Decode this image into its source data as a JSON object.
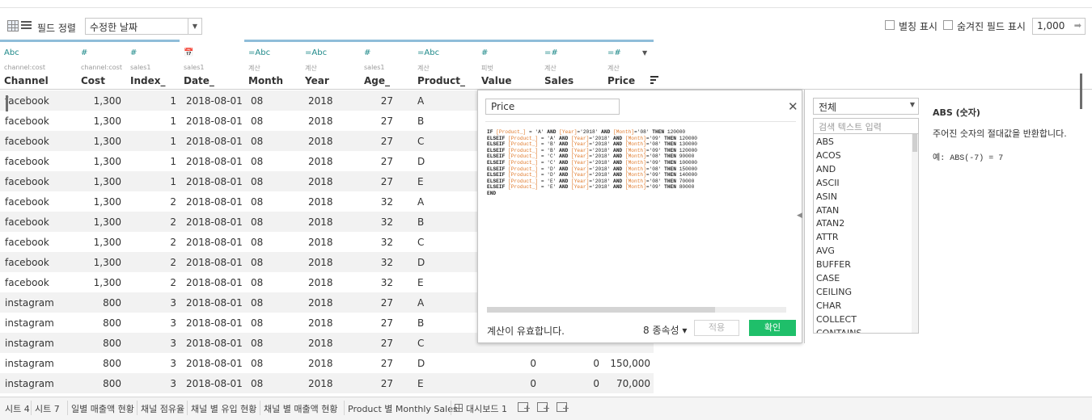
{
  "toolbar": {
    "sort_label": "필드 정렬",
    "sort_value": "수정한 날짜",
    "alias_label": "별칭 표시",
    "hidden_label": "숨겨진 필드 표시",
    "rows_value": "1,000"
  },
  "columns": [
    {
      "type": "Abc",
      "source": "channel:cost",
      "name": "Channel"
    },
    {
      "type": "#",
      "source": "channel:cost",
      "name": "Cost"
    },
    {
      "type": "#",
      "source": "sales1",
      "name": "Index_"
    },
    {
      "type": "📅",
      "source": "sales1",
      "name": "Date_"
    },
    {
      "type": "=Abc",
      "source": "계산",
      "name": "Month"
    },
    {
      "type": "=Abc",
      "source": "계산",
      "name": "Year"
    },
    {
      "type": "#",
      "source": "sales1",
      "name": "Age_"
    },
    {
      "type": "=Abc",
      "source": "계산",
      "name": "Product_"
    },
    {
      "type": "#",
      "source": "피벗",
      "name": "Value"
    },
    {
      "type": "=#",
      "source": "계산",
      "name": "Sales"
    },
    {
      "type": "=#",
      "source": "계산",
      "name": "Price"
    }
  ],
  "rows": [
    {
      "channel": "facebook",
      "cost": "1,300",
      "index": "1",
      "date": "2018-08-01",
      "month": "08",
      "year": "2018",
      "age": "27",
      "product": "A"
    },
    {
      "channel": "facebook",
      "cost": "1,300",
      "index": "1",
      "date": "2018-08-01",
      "month": "08",
      "year": "2018",
      "age": "27",
      "product": "B"
    },
    {
      "channel": "facebook",
      "cost": "1,300",
      "index": "1",
      "date": "2018-08-01",
      "month": "08",
      "year": "2018",
      "age": "27",
      "product": "C"
    },
    {
      "channel": "facebook",
      "cost": "1,300",
      "index": "1",
      "date": "2018-08-01",
      "month": "08",
      "year": "2018",
      "age": "27",
      "product": "D"
    },
    {
      "channel": "facebook",
      "cost": "1,300",
      "index": "1",
      "date": "2018-08-01",
      "month": "08",
      "year": "2018",
      "age": "27",
      "product": "E"
    },
    {
      "channel": "facebook",
      "cost": "1,300",
      "index": "2",
      "date": "2018-08-01",
      "month": "08",
      "year": "2018",
      "age": "32",
      "product": "A"
    },
    {
      "channel": "facebook",
      "cost": "1,300",
      "index": "2",
      "date": "2018-08-01",
      "month": "08",
      "year": "2018",
      "age": "32",
      "product": "B"
    },
    {
      "channel": "facebook",
      "cost": "1,300",
      "index": "2",
      "date": "2018-08-01",
      "month": "08",
      "year": "2018",
      "age": "32",
      "product": "C"
    },
    {
      "channel": "facebook",
      "cost": "1,300",
      "index": "2",
      "date": "2018-08-01",
      "month": "08",
      "year": "2018",
      "age": "32",
      "product": "D"
    },
    {
      "channel": "facebook",
      "cost": "1,300",
      "index": "2",
      "date": "2018-08-01",
      "month": "08",
      "year": "2018",
      "age": "32",
      "product": "E"
    },
    {
      "channel": "instagram",
      "cost": "800",
      "index": "3",
      "date": "2018-08-01",
      "month": "08",
      "year": "2018",
      "age": "27",
      "product": "A"
    },
    {
      "channel": "instagram",
      "cost": "800",
      "index": "3",
      "date": "2018-08-01",
      "month": "08",
      "year": "2018",
      "age": "27",
      "product": "B"
    },
    {
      "channel": "instagram",
      "cost": "800",
      "index": "3",
      "date": "2018-08-01",
      "month": "08",
      "year": "2018",
      "age": "27",
      "product": "C"
    },
    {
      "channel": "instagram",
      "cost": "800",
      "index": "3",
      "date": "2018-08-01",
      "month": "08",
      "year": "2018",
      "age": "27",
      "product": "D",
      "value": "0",
      "sales": "0",
      "price": "150,000"
    },
    {
      "channel": "instagram",
      "cost": "800",
      "index": "3",
      "date": "2018-08-01",
      "month": "08",
      "year": "2018",
      "age": "27",
      "product": "E",
      "value": "0",
      "sales": "0",
      "price": "70,000"
    }
  ],
  "calc": {
    "name": "Price",
    "code": [
      [
        [
          "kw",
          "IF "
        ],
        [
          "fld",
          "[Product_]"
        ],
        [
          "t",
          " = 'A' "
        ],
        [
          "kw",
          "AND "
        ],
        [
          "fld",
          "[Year]"
        ],
        [
          "t",
          "='2018' "
        ],
        [
          "kw",
          "AND "
        ],
        [
          "fld",
          "[Month]"
        ],
        [
          "t",
          "='08' "
        ],
        [
          "kw",
          "THEN "
        ],
        [
          "t",
          "120000"
        ]
      ],
      [
        [
          "kw",
          "ELSEIF "
        ],
        [
          "fld",
          "[Product_]"
        ],
        [
          "t",
          " = 'A' "
        ],
        [
          "kw",
          "AND "
        ],
        [
          "fld",
          "[Year]"
        ],
        [
          "t",
          "='2018' "
        ],
        [
          "kw",
          "AND "
        ],
        [
          "fld",
          "[Month]"
        ],
        [
          "t",
          "='09' "
        ],
        [
          "kw",
          "THEN "
        ],
        [
          "t",
          "120000"
        ]
      ],
      [
        [
          "kw",
          "ELSEIF "
        ],
        [
          "fld",
          "[Product_]"
        ],
        [
          "t",
          " = 'B' "
        ],
        [
          "kw",
          "AND "
        ],
        [
          "fld",
          "[Year]"
        ],
        [
          "t",
          "='2018' "
        ],
        [
          "kw",
          "AND "
        ],
        [
          "fld",
          "[Month]"
        ],
        [
          "t",
          "='08' "
        ],
        [
          "kw",
          "THEN "
        ],
        [
          "t",
          "130000"
        ]
      ],
      [
        [
          "kw",
          "ELSEIF "
        ],
        [
          "fld",
          "[Product_]"
        ],
        [
          "t",
          " = 'B' "
        ],
        [
          "kw",
          "AND "
        ],
        [
          "fld",
          "[Year]"
        ],
        [
          "t",
          "='2018' "
        ],
        [
          "kw",
          "AND "
        ],
        [
          "fld",
          "[Month]"
        ],
        [
          "t",
          "='09' "
        ],
        [
          "kw",
          "THEN "
        ],
        [
          "t",
          "120000"
        ]
      ],
      [
        [
          "kw",
          "ELSEIF "
        ],
        [
          "fld",
          "[Product_]"
        ],
        [
          "t",
          " = 'C' "
        ],
        [
          "kw",
          "AND "
        ],
        [
          "fld",
          "[Year]"
        ],
        [
          "t",
          "='2018' "
        ],
        [
          "kw",
          "AND "
        ],
        [
          "fld",
          "[Month]"
        ],
        [
          "t",
          "='08' "
        ],
        [
          "kw",
          "THEN "
        ],
        [
          "t",
          "90000"
        ]
      ],
      [
        [
          "kw",
          "ELSEIF "
        ],
        [
          "fld",
          "[Product_]"
        ],
        [
          "t",
          " = 'C' "
        ],
        [
          "kw",
          "AND "
        ],
        [
          "fld",
          "[Year]"
        ],
        [
          "t",
          "='2018' "
        ],
        [
          "kw",
          "AND "
        ],
        [
          "fld",
          "[Month]"
        ],
        [
          "t",
          "='09' "
        ],
        [
          "kw",
          "THEN "
        ],
        [
          "t",
          "100000"
        ]
      ],
      [
        [
          "kw",
          "ELSEIF "
        ],
        [
          "fld",
          "[Product_]"
        ],
        [
          "t",
          " = 'D' "
        ],
        [
          "kw",
          "AND "
        ],
        [
          "fld",
          "[Year]"
        ],
        [
          "t",
          "='2018' "
        ],
        [
          "kw",
          "AND "
        ],
        [
          "fld",
          "[Month]"
        ],
        [
          "t",
          "='08' "
        ],
        [
          "kw",
          "THEN "
        ],
        [
          "t",
          "150000"
        ]
      ],
      [
        [
          "kw",
          "ELSEIF "
        ],
        [
          "fld",
          "[Product_]"
        ],
        [
          "t",
          " = 'D' "
        ],
        [
          "kw",
          "AND "
        ],
        [
          "fld",
          "[Year]"
        ],
        [
          "t",
          "='2018' "
        ],
        [
          "kw",
          "AND "
        ],
        [
          "fld",
          "[Month]"
        ],
        [
          "t",
          "='09' "
        ],
        [
          "kw",
          "THEN "
        ],
        [
          "t",
          "140000"
        ]
      ],
      [
        [
          "kw",
          "ELSEIF "
        ],
        [
          "fld",
          "[Product_]"
        ],
        [
          "t",
          " = 'E' "
        ],
        [
          "kw",
          "AND "
        ],
        [
          "fld",
          "[Year]"
        ],
        [
          "t",
          "='2018' "
        ],
        [
          "kw",
          "AND "
        ],
        [
          "fld",
          "[Month]"
        ],
        [
          "t",
          "='08' "
        ],
        [
          "kw",
          "THEN "
        ],
        [
          "t",
          "70000"
        ]
      ],
      [
        [
          "kw",
          "ELSEIF "
        ],
        [
          "fld",
          "[Product_]"
        ],
        [
          "t",
          " = 'E' "
        ],
        [
          "kw",
          "AND "
        ],
        [
          "fld",
          "[Year]"
        ],
        [
          "t",
          "='2018' "
        ],
        [
          "kw",
          "AND "
        ],
        [
          "fld",
          "[Month]"
        ],
        [
          "t",
          "='09' "
        ],
        [
          "kw",
          "THEN "
        ],
        [
          "t",
          "80000"
        ]
      ],
      [
        [
          "kw",
          "END"
        ]
      ]
    ],
    "status": "계산이 유효합니다.",
    "dependencies": "8 종속성",
    "apply_label": "적용",
    "ok_label": "확인"
  },
  "functions": {
    "filter": "전체",
    "search_placeholder": "검색 텍스트 입력",
    "items": [
      "ABS",
      "ACOS",
      "AND",
      "ASCII",
      "ASIN",
      "ATAN",
      "ATAN2",
      "ATTR",
      "AVG",
      "BUFFER",
      "CASE",
      "CEILING",
      "CHAR",
      "COLLECT",
      "CONTAINS"
    ],
    "title": "ABS (숫자)",
    "description": "주어진 숫자의 절대값을 반환합니다.",
    "example": "예: ABS(-7) = 7"
  },
  "tabs": [
    "시트 4",
    "시트 7",
    "일별 매출액 현황",
    "채널 점유율",
    "채널 별 유입 현황",
    "채널 별 매출액 현황",
    "Product 별 Monthly Sales",
    "대시보드 1"
  ],
  "colors": {
    "accent": "#1fbf6a",
    "field": "#e07a2b",
    "type": "#1f8a8a",
    "header_bar": "#8fbdd9"
  }
}
